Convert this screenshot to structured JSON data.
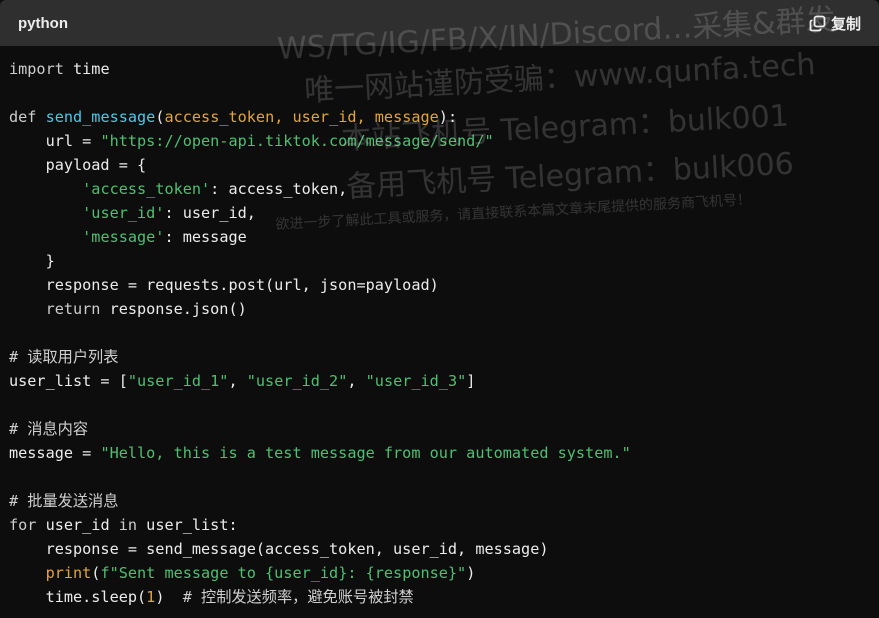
{
  "header": {
    "language": "python",
    "copy_label": "复制",
    "copy_icon": "copy-icon"
  },
  "watermark": [
    "WS/TG/IG/FB/X/IN/Discord…采集&群发",
    "唯一网站谨防受骗：www.qunfa.tech",
    "本站飞机号 Telegram：bulk001",
    "备用飞机号 Telegram：bulk006",
    "欲进一步了解此工具或服务，请直接联系本篇文章末尾提供的服务商飞机号！"
  ],
  "colors": {
    "background": "#0d0d0d",
    "header_background": "#2f2f2f",
    "function_name": "#4cc9e6",
    "parameter": "#e2a53a",
    "string": "#4fbf73",
    "text": "#ececec"
  },
  "code": [
    [
      [
        "k",
        "import"
      ],
      [
        "p",
        " time"
      ]
    ],
    [],
    [
      [
        "k",
        "def"
      ],
      [
        "p",
        " "
      ],
      [
        "f",
        "send_message"
      ],
      [
        "p",
        "("
      ],
      [
        "a",
        "access_token, user_id, message"
      ],
      [
        "p",
        "):"
      ]
    ],
    [
      [
        "p",
        "    url = "
      ],
      [
        "s",
        "\"https://open-api.tiktok.com/message/send/\""
      ]
    ],
    [
      [
        "p",
        "    payload = {"
      ]
    ],
    [
      [
        "p",
        "        "
      ],
      [
        "s",
        "'access_token'"
      ],
      [
        "p",
        ": access_token,"
      ]
    ],
    [
      [
        "p",
        "        "
      ],
      [
        "s",
        "'user_id'"
      ],
      [
        "p",
        ": user_id,"
      ]
    ],
    [
      [
        "p",
        "        "
      ],
      [
        "s",
        "'message'"
      ],
      [
        "p",
        ": message"
      ]
    ],
    [
      [
        "p",
        "    }"
      ]
    ],
    [
      [
        "p",
        "    response = requests.post(url, json=payload)"
      ]
    ],
    [
      [
        "k",
        "    return"
      ],
      [
        "p",
        " response.json()"
      ]
    ],
    [],
    [
      [
        "c",
        "# 读取用户列表"
      ]
    ],
    [
      [
        "p",
        "user_list = ["
      ],
      [
        "s",
        "\"user_id_1\""
      ],
      [
        "p",
        ", "
      ],
      [
        "s",
        "\"user_id_2\""
      ],
      [
        "p",
        ", "
      ],
      [
        "s",
        "\"user_id_3\""
      ],
      [
        "p",
        "]"
      ]
    ],
    [],
    [
      [
        "c",
        "# 消息内容"
      ]
    ],
    [
      [
        "p",
        "message = "
      ],
      [
        "s",
        "\"Hello, this is a test message from our automated system.\""
      ]
    ],
    [],
    [
      [
        "c",
        "# 批量发送消息"
      ]
    ],
    [
      [
        "k",
        "for"
      ],
      [
        "p",
        " user_id "
      ],
      [
        "k",
        "in"
      ],
      [
        "p",
        " user_list:"
      ]
    ],
    [
      [
        "p",
        "    response = send_message(access_token, user_id, message)"
      ]
    ],
    [
      [
        "p",
        "    "
      ],
      [
        "b",
        "print"
      ],
      [
        "p",
        "("
      ],
      [
        "s",
        "f\"Sent message to {user_id}: {response}\""
      ],
      [
        "p",
        ")"
      ]
    ],
    [
      [
        "p",
        "    time.sleep("
      ],
      [
        "n",
        "1"
      ],
      [
        "p",
        ")  "
      ],
      [
        "c",
        "# 控制发送频率，避免账号被封禁"
      ]
    ]
  ]
}
